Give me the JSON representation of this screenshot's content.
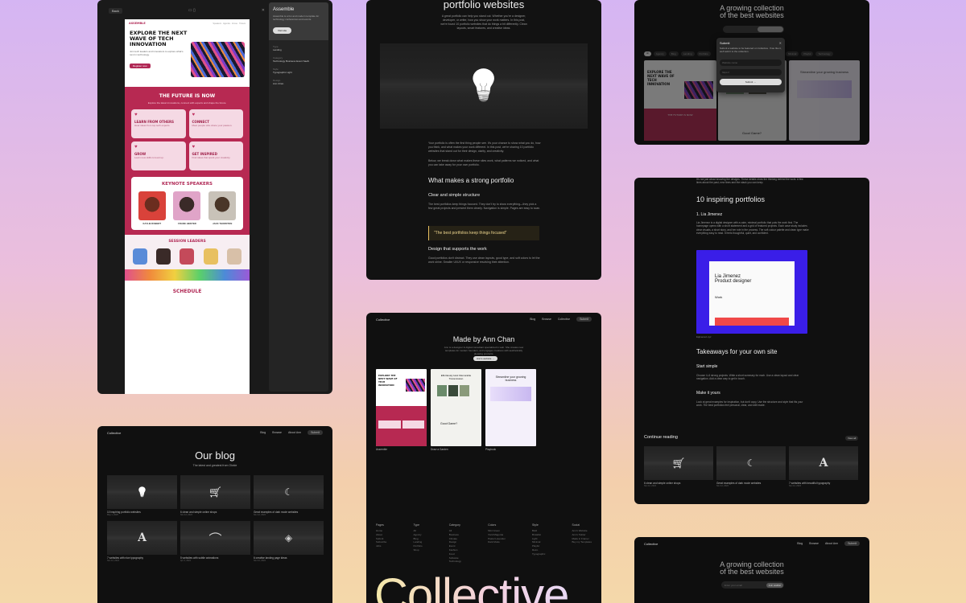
{
  "event": {
    "back_label": "Back",
    "brand": "ASSEMBLE",
    "hero_title": "EXPLORE THE NEXT WAVE OF TECH INNOVATION",
    "hero_button": "Register now",
    "future_title": "THE FUTURE IS NOW",
    "cards": [
      "LEARN FROM OTHERS",
      "CONNECT",
      "GROW",
      "GET INSPIRED"
    ],
    "keynote_title": "KEYNOTE SPEAKERS",
    "speakers": [
      "KAYLIE ROBERT",
      "FRANK HEISTER",
      "JACK THORNTON"
    ],
    "session_title": "SESSION LEADERS",
    "schedule_title": "SCHEDULE",
    "side": {
      "title": "Assemble",
      "desc": "Assemble is a fun and modern template for technology conferences and events.",
      "button": "Visit site",
      "type_label": "Type",
      "type_value": "Landing",
      "category_label": "Category",
      "categories": [
        "Technology",
        "Business",
        "Event",
        "SaaS"
      ],
      "style_label": "Style",
      "styles": [
        "Typographic",
        "Light"
      ],
      "design_label": "Design",
      "design_value": "Ann Chan"
    }
  },
  "article": {
    "title": "portfolio websites",
    "intro": "A great portfolio can help you stand out. Whether you're a designer, developer, or writer, how you show your work matters. In this post, we're found 10 portfolio websites that do things a bit differently. Clean layouts, smart features, and creative ideas.",
    "para": "Your portfolio is often the first thing people see. It's your chance to show what you do, how you think, and what makes your work different. In this post, we're sharing 10 portfolio websites that stand out for their design, clarity, and creativity.",
    "para2": "Below, we break down what makes these sites work, what patterns we noticed, and what you can take away for your own portfolio.",
    "h2": "What makes a strong portfolio",
    "h3": "Clear and simple structure",
    "para3": "The best portfolios keep things focused. They don't try to show everything—they pick a few great projects and present them clearly. Navigation is simple. Pages are easy to scan.",
    "quote": "“The best portfolios keep things focused”",
    "h3b": "Design that supports the work",
    "para4": "Good portfolios don't distract. They use clean layouts, good type, and soft colors to let the work shine. Smaller UI/UX or responsive resolving their attention."
  },
  "collection_modal": {
    "title_line1": "A growing collection",
    "title_line2": "of the best websites",
    "modal_title": "Submit",
    "modal_desc": "Submit a website to be featured on Collective. If we like it, we'll add it to the collection.",
    "name_placeholder": "Website name",
    "url_placeholder": "https://",
    "submit_button": "Submit →",
    "filters": [
      "All",
      "Agency",
      "Blog",
      "Landing",
      "Portfolio",
      "SaaS",
      "Startup",
      "Minimal",
      "Playful",
      "Technology"
    ],
    "good_game": "Good Game?",
    "future": "THE FUTURE IS NOW"
  },
  "inspiring": {
    "intro": "It's not just about knowing the designs. These details show the thinking behind the work. A few lines about the past, new lines and the stack you can keep.",
    "title": "10 inspiring portfolios",
    "item": "1. Lia Jimenez",
    "item_desc": "Lia Jimenez is a digital designer with a calm, minimal portfolio that puts the work first. The homepage opens with a short statement and a grid of featured projects. Each case study includes clear visuals, a short story, and her role in the process. The soft colour palette and clean type make everything easy to read. It feels thoughtful, quiet, and confident.",
    "shot_name": "Lia Jimenez",
    "shot_role": "Product designer",
    "shot_work": "Work",
    "caption": "lisjimenez.xyz",
    "takeaways": "Takeaways for your own site",
    "start": "Start simple",
    "start_desc": "Choose 4–6 strong projects. Write a short summary for each. Use a clean layout and clear navigation. Add a clear way to get in touch.",
    "make": "Make it yours",
    "make_desc": "Look at great examples for inspiration, but don't copy. Use the structure and style that fits your work. The best portfolios feel personal, clear, and well made.",
    "continue": "Continue reading",
    "view_all": "View all",
    "reads": [
      {
        "title": "6 clean and simple online shops",
        "date": "Nov 12, 2024"
      },
      {
        "title": "Great examples of dark mode websites",
        "date": "Nov 12, 2024"
      },
      {
        "title": "7 websites with beautiful typography",
        "date": "Nov 12, 2024"
      }
    ]
  },
  "blog": {
    "brand": "Collective",
    "nav": [
      "Blog",
      "Browse",
      "About Ann"
    ],
    "nav_btn": "Submit",
    "title": "Our blog",
    "subtitle": "The latest and greatest from Olvide",
    "posts": [
      {
        "title": "10 inspiring portfolio websites",
        "date": "May 1, 2025",
        "icon": "💡"
      },
      {
        "title": "6 clean and simple online shops",
        "date": "Nov 12, 2024",
        "icon": "🛒"
      },
      {
        "title": "Great examples of dark mode websites",
        "date": "Nov 12, 2024",
        "icon": "☾"
      },
      {
        "title": "7 websites with nice typography",
        "date": "Nov 12, 2024",
        "icon": "A"
      },
      {
        "title": "5 websites with subtle animations",
        "date": "Apr 4, 2024",
        "icon": "⌒"
      },
      {
        "title": "6 creative landing page ideas",
        "date": "Nov 12, 2024",
        "icon": "◈"
      }
    ]
  },
  "made_by": {
    "brand": "Collective",
    "nav": [
      "Blog",
      "Browse",
      "Collective"
    ],
    "nav_btn": "Submit",
    "title": "Made by Ann Chan",
    "desc": "Ann is a designer & digital consultant specialized in web. She creates new templates for modern founders, and engages creatives with aesthetically pleasing products.",
    "button": "Ann's website →",
    "shots": [
      "Assemble",
      "Draw a Garden",
      "Playbook"
    ],
    "shot_titles": [
      "EXPLORE THE NEXT WAVE OF TECH INNOVATION",
      "Effortlessly Host Memorable Transmission",
      "Streamline your growing business"
    ],
    "footer_cols": [
      {
        "head": "Pages",
        "items": [
          "Home",
          "About",
          "Submit",
          "Subscribe",
          "Jobs"
        ]
      },
      {
        "head": "Type",
        "items": [
          "All",
          "Agency",
          "Blog",
          "Landing",
          "Portfolio",
          "Shop"
        ]
      },
      {
        "head": "Category",
        "items": [
          "All",
          "Business",
          "Climate",
          "Design",
          "Event",
          "Fashion",
          "Food",
          "Software",
          "Technology"
        ]
      },
      {
        "head": "Colors",
        "items": [
          "Mint Green",
          "Vivid Magenta",
          "Pastel Lavender",
          "Dark Mode"
        ]
      },
      {
        "head": "Style",
        "items": [
          "Bold",
          "Brutalist",
          "Light",
          "Minimal",
          "Playful",
          "Retro",
          "Typographic"
        ]
      },
      {
        "head": "Social",
        "items": [
          "Ann's Website",
          "Ann's Twitter",
          "Made in Framer",
          "Buy my Templates"
        ]
      }
    ],
    "big": "Collective"
  },
  "collection_bottom": {
    "brand": "Collective",
    "nav": [
      "Blog",
      "Browse",
      "About Ann"
    ],
    "nav_btn": "Submit",
    "title_line1": "A growing collection",
    "title_line2": "of the best websites",
    "input_placeholder": "Enter your email",
    "button": "Join waitlist"
  }
}
